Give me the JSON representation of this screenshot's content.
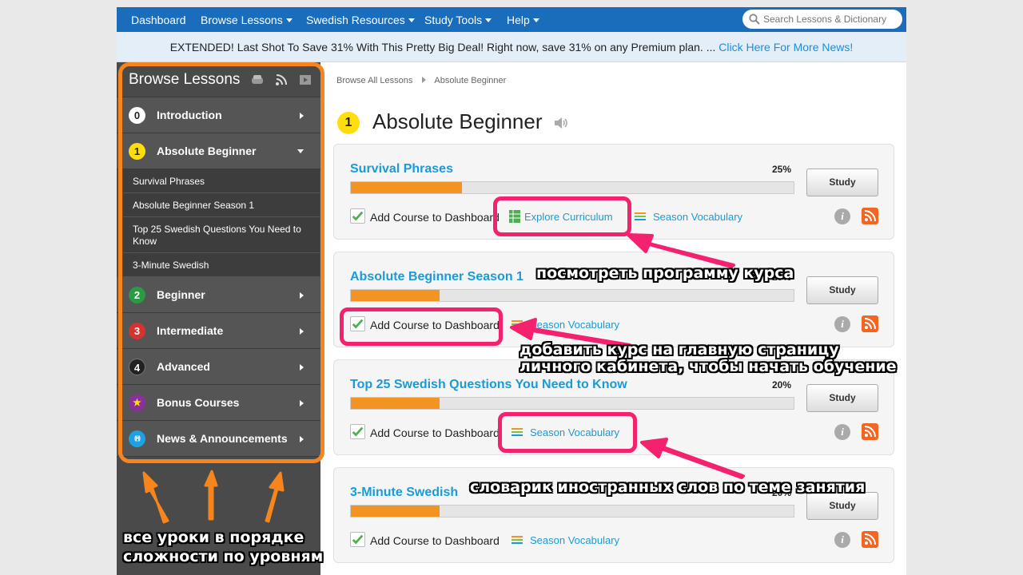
{
  "nav": {
    "items": [
      {
        "label": "Dashboard",
        "dropdown": false
      },
      {
        "label": "Browse Lessons",
        "dropdown": true
      },
      {
        "label": "Swedish Resources",
        "dropdown": true
      },
      {
        "label": "Study Tools",
        "dropdown": true
      },
      {
        "label": "Help",
        "dropdown": true
      }
    ],
    "search_placeholder": "Search Lessons & Dictionary"
  },
  "promo": {
    "text": "EXTENDED! Last Shot To Save 31% With This Pretty Big Deal! Right now, save 31% on any Premium plan. ... ",
    "link": "Click Here For More News!"
  },
  "sidebar": {
    "title": "Browse Lessons",
    "levels": [
      {
        "num": "0",
        "label": "Introduction",
        "color": "#ffffff",
        "text_color": "#222222"
      },
      {
        "num": "1",
        "label": "Absolute Beginner",
        "color": "#ffde10",
        "text_color": "#222222",
        "expanded": true
      },
      {
        "num": "2",
        "label": "Beginner",
        "color": "#2a9a45",
        "text_color": "#ffffff"
      },
      {
        "num": "3",
        "label": "Intermediate",
        "color": "#d6322f",
        "text_color": "#ffffff"
      },
      {
        "num": "4",
        "label": "Advanced",
        "color": "#222222",
        "text_color": "#ffffff"
      },
      {
        "num": "★",
        "label": "Bonus Courses",
        "color": "#8a2f9c",
        "text_color": "#ffde10"
      },
      {
        "num": "((•))",
        "label": "News & Announcements",
        "color": "#1ea1e0",
        "text_color": "#ffffff"
      }
    ],
    "subitems": [
      "Survival Phrases",
      "Absolute Beginner Season 1",
      "Top 25 Swedish Questions You Need to Know",
      "3-Minute Swedish"
    ]
  },
  "breadcrumb": {
    "root": "Browse All Lessons",
    "current": "Absolute Beginner"
  },
  "level": {
    "num": "1",
    "title": "Absolute Beginner"
  },
  "courses": [
    {
      "title": "Survival Phrases",
      "percent": "25%",
      "progress": 0.25,
      "study": "Study",
      "add": "Add Course to Dashboard",
      "links": [
        "Explore Curriculum",
        "Season Vocabulary"
      ]
    },
    {
      "title": "Absolute Beginner Season 1",
      "percent": "20%",
      "progress": 0.2,
      "study": "Study",
      "add": "Add Course to Dashboard",
      "links": [
        "Season Vocabulary"
      ]
    },
    {
      "title": "Top 25 Swedish Questions You Need to Know",
      "percent": "20%",
      "progress": 0.2,
      "study": "Study",
      "add": "Add Course to Dashboard",
      "links": [
        "Season Vocabulary"
      ]
    },
    {
      "title": "3-Minute Swedish",
      "percent": "20%",
      "progress": 0.2,
      "study": "Study",
      "add": "Add Course to Dashboard",
      "links": [
        "Season Vocabulary"
      ]
    }
  ],
  "annotations": {
    "curriculum": "посмотреть программу курса",
    "dashboard_line1": "добавить курс на главную страницу",
    "dashboard_line2": "личного кабинета, чтобы начать обучение",
    "vocab": "словарик иностранных слов по теме занятия",
    "levels_line1": "все уроки в порядке",
    "levels_line2": "сложности по уровням"
  },
  "colors": {
    "nav": "#1a6dbb",
    "accent": "#1a9bd7",
    "progress": "#f39422",
    "highlight": "#f4226e",
    "sidebar_outline": "#f7851e"
  }
}
